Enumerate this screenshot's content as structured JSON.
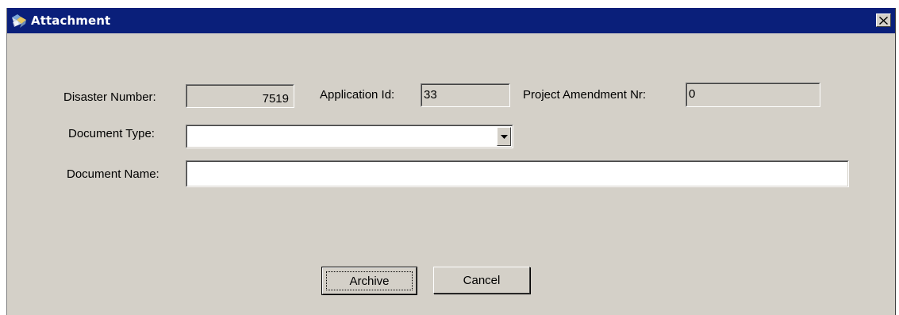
{
  "window": {
    "title": "Attachment",
    "close_glyph": "✕",
    "icon": "attachment-app-icon"
  },
  "form": {
    "disaster_number_label": "Disaster Number:",
    "disaster_number_value": "7519",
    "application_id_label": "Application Id:",
    "application_id_value": "33",
    "project_amendment_label": "Project Amendment Nr:",
    "project_amendment_value": "0",
    "document_type_label": "Document Type:",
    "document_type_value": "",
    "document_name_label": "Document Name:",
    "document_name_value": ""
  },
  "buttons": {
    "archive_label": "Archive",
    "cancel_label": "Cancel"
  },
  "colors": {
    "titlebar": "#0a1f7a",
    "dialog_face": "#d4d0c8"
  }
}
